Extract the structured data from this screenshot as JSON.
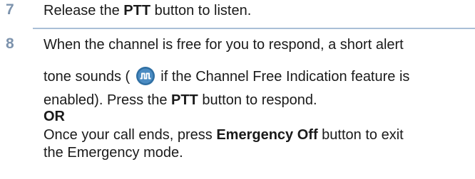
{
  "step7": {
    "number": "7",
    "text_before": "Release the ",
    "bold": "PTT",
    "text_after": " button to listen."
  },
  "step8": {
    "number": "8",
    "line1": "When the channel is free for you to respond, a short alert",
    "line2_before": "tone sounds ( ",
    "line2_after": " if the Channel Free Indication feature is",
    "icon": "channel-free-indication-icon",
    "line3_before": "enabled). Press the ",
    "line3_bold": "PTT",
    "line3_after": " button to respond.",
    "or": "OR",
    "line5_before": "Once your call ends, press ",
    "line5_bold": "Emergency Off",
    "line5_after": " button to exit",
    "line6": "the Emergency mode."
  },
  "colors": {
    "step_number": "#7d93ad",
    "rule": "#a9bfd6",
    "icon_fill": "#2f6fa3"
  }
}
